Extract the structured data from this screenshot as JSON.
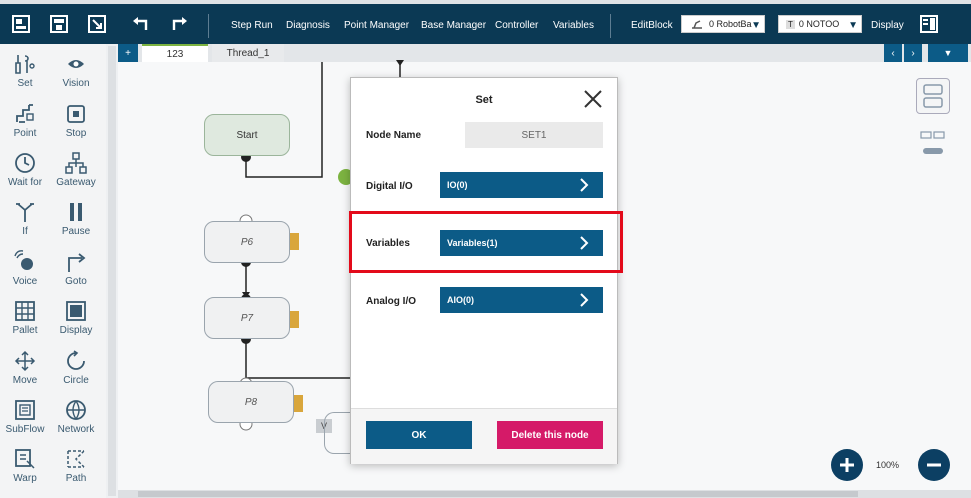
{
  "toolbar": {
    "menus": [
      "Step Run",
      "Diagnosis",
      "Point Manager",
      "Base Manager",
      "Controller",
      "Variables",
      "EditBlock"
    ],
    "robot_select": "0 RobotBa",
    "tool_select": "0 NOTOO",
    "tool_badge": "T",
    "display_label": "Display"
  },
  "tabs": {
    "add_label": "+",
    "items": [
      "123",
      "Thread_1"
    ]
  },
  "palette": [
    {
      "label": "Set",
      "icon": "set-icon"
    },
    {
      "label": "Vision",
      "icon": "vision-icon"
    },
    {
      "label": "Point",
      "icon": "point-icon"
    },
    {
      "label": "Stop",
      "icon": "stop-icon"
    },
    {
      "label": "Wait for",
      "icon": "wait-icon"
    },
    {
      "label": "Gateway",
      "icon": "gateway-icon"
    },
    {
      "label": "If",
      "icon": "if-icon"
    },
    {
      "label": "Pause",
      "icon": "pause-icon"
    },
    {
      "label": "Voice",
      "icon": "voice-icon"
    },
    {
      "label": "Goto",
      "icon": "goto-icon"
    },
    {
      "label": "Pallet",
      "icon": "pallet-icon"
    },
    {
      "label": "Display",
      "icon": "display-icon"
    },
    {
      "label": "Move",
      "icon": "move-icon"
    },
    {
      "label": "Circle",
      "icon": "circle-icon"
    },
    {
      "label": "SubFlow",
      "icon": "subflow-icon"
    },
    {
      "label": "Network",
      "icon": "network-icon"
    },
    {
      "label": "Warp",
      "icon": "warp-icon"
    },
    {
      "label": "Path",
      "icon": "path-icon"
    }
  ],
  "flow": {
    "start": "Start",
    "p6": "P6",
    "p7": "P7",
    "p8": "P8",
    "v": "V"
  },
  "modal": {
    "title": "Set",
    "node_name_label": "Node Name",
    "node_name_value": "SET1",
    "digital_io_label": "Digital I/O",
    "digital_io_value": "IO(0)",
    "variables_label": "Variables",
    "variables_value": "Variables(1)",
    "analog_io_label": "Analog I/O",
    "analog_io_value": "AIO(0)",
    "ok_label": "OK",
    "delete_label": "Delete this node"
  },
  "zoom": {
    "level": "100%"
  },
  "colors": {
    "toolbar": "#0b3954",
    "primary": "#0c5b87",
    "danger": "#d51a68",
    "highlight": "#e30a1a"
  }
}
